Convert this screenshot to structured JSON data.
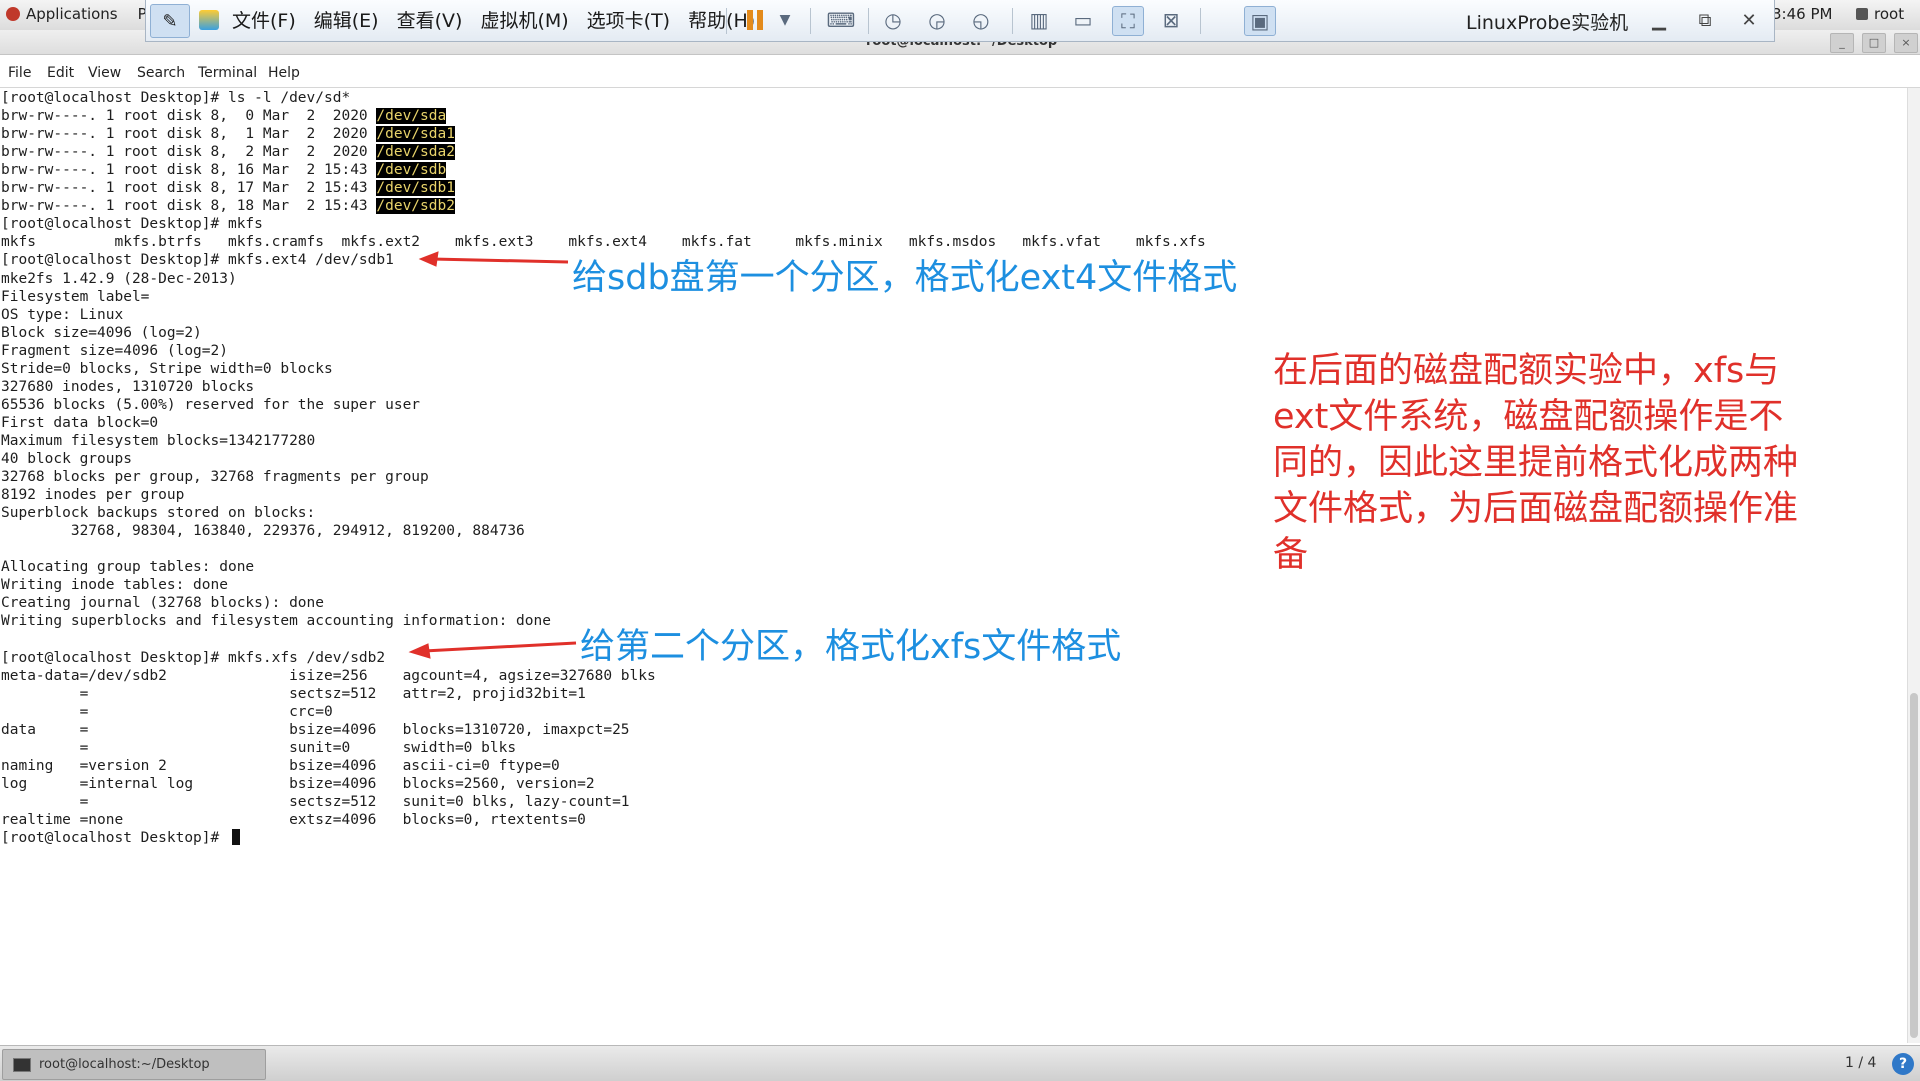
{
  "gnome_bar": {
    "applications": "Applications",
    "places": "Pl",
    "clock": "3:46 PM",
    "user": "root"
  },
  "vm_toolbar": {
    "menus": [
      "文件(F)",
      "编辑(E)",
      "查看(V)",
      "虚拟机(M)",
      "选项卡(T)",
      "帮助(H)"
    ],
    "title": "LinuxProbe实验机",
    "icons": [
      "pin-icon",
      "vmware-logo-icon",
      "pause-icon",
      "dropdown-icon",
      "send-keys-icon",
      "snapshot-icon",
      "snapshot-restore-icon",
      "snapshot-manager-icon",
      "sidebar-view-icon",
      "thumbnail-view-icon",
      "fullscreen-icon",
      "unity-icon",
      "console-view-icon"
    ]
  },
  "terminal": {
    "title": "root@localhost:~/Desktop",
    "menu": [
      "File",
      "Edit",
      "View",
      "Search",
      "Terminal",
      "Help"
    ],
    "lines": [
      {
        "text": "[root@localhost Desktop]# ls -l /dev/sd*"
      },
      {
        "text": "brw-rw----. 1 root disk 8,  0 Mar  2  2020 ",
        "hl": "/dev/sda"
      },
      {
        "text": "brw-rw----. 1 root disk 8,  1 Mar  2  2020 ",
        "hl": "/dev/sda1"
      },
      {
        "text": "brw-rw----. 1 root disk 8,  2 Mar  2  2020 ",
        "hl": "/dev/sda2"
      },
      {
        "text": "brw-rw----. 1 root disk 8, 16 Mar  2 15:43 ",
        "hl": "/dev/sdb"
      },
      {
        "text": "brw-rw----. 1 root disk 8, 17 Mar  2 15:43 ",
        "hl": "/dev/sdb1"
      },
      {
        "text": "brw-rw----. 1 root disk 8, 18 Mar  2 15:43 ",
        "hl": "/dev/sdb2"
      },
      {
        "text": "[root@localhost Desktop]# mkfs"
      },
      {
        "text": "mkfs         mkfs.btrfs   mkfs.cramfs  mkfs.ext2    mkfs.ext3    mkfs.ext4    mkfs.fat     mkfs.minix   mkfs.msdos   mkfs.vfat    mkfs.xfs"
      },
      {
        "text": "[root@localhost Desktop]# mkfs.ext4 /dev/sdb1"
      },
      {
        "text": "mke2fs 1.42.9 (28-Dec-2013)"
      },
      {
        "text": "Filesystem label="
      },
      {
        "text": "OS type: Linux"
      },
      {
        "text": "Block size=4096 (log=2)"
      },
      {
        "text": "Fragment size=4096 (log=2)"
      },
      {
        "text": "Stride=0 blocks, Stripe width=0 blocks"
      },
      {
        "text": "327680 inodes, 1310720 blocks"
      },
      {
        "text": "65536 blocks (5.00%) reserved for the super user"
      },
      {
        "text": "First data block=0"
      },
      {
        "text": "Maximum filesystem blocks=1342177280"
      },
      {
        "text": "40 block groups"
      },
      {
        "text": "32768 blocks per group, 32768 fragments per group"
      },
      {
        "text": "8192 inodes per group"
      },
      {
        "text": "Superblock backups stored on blocks:"
      },
      {
        "text": "        32768, 98304, 163840, 229376, 294912, 819200, 884736"
      },
      {
        "text": ""
      },
      {
        "text": "Allocating group tables: done"
      },
      {
        "text": "Writing inode tables: done"
      },
      {
        "text": "Creating journal (32768 blocks): done"
      },
      {
        "text": "Writing superblocks and filesystem accounting information: done"
      },
      {
        "text": ""
      },
      {
        "text": "[root@localhost Desktop]# mkfs.xfs /dev/sdb2"
      },
      {
        "text": "meta-data=/dev/sdb2              isize=256    agcount=4, agsize=327680 blks"
      },
      {
        "text": "         =                       sectsz=512   attr=2, projid32bit=1"
      },
      {
        "text": "         =                       crc=0"
      },
      {
        "text": "data     =                       bsize=4096   blocks=1310720, imaxpct=25"
      },
      {
        "text": "         =                       sunit=0      swidth=0 blks"
      },
      {
        "text": "naming   =version 2              bsize=4096   ascii-ci=0 ftype=0"
      },
      {
        "text": "log      =internal log           bsize=4096   blocks=2560, version=2"
      },
      {
        "text": "         =                       sectsz=512   sunit=0 blks, lazy-count=1"
      },
      {
        "text": "realtime =none                   extsz=4096   blocks=0, rtextents=0"
      },
      {
        "text": "[root@localhost Desktop]# ",
        "cursor": true
      }
    ]
  },
  "annotations": {
    "ext4_note": "给sdb盘第一个分区，格式化ext4文件格式",
    "xfs_note": "给第二个分区，格式化xfs文件格式",
    "side_note": [
      "在后面的磁盘配额实验中，xfs与",
      "ext文件系统，磁盘配额操作是不",
      "同的，因此这里提前格式化成两种",
      "文件格式，为后面磁盘配额操作准",
      "备"
    ],
    "blue": "#1d8fe0",
    "red": "#e0302a"
  },
  "taskbar": {
    "task_label": "root@localhost:~/Desktop",
    "pager": "1 / 4",
    "help": "?"
  }
}
